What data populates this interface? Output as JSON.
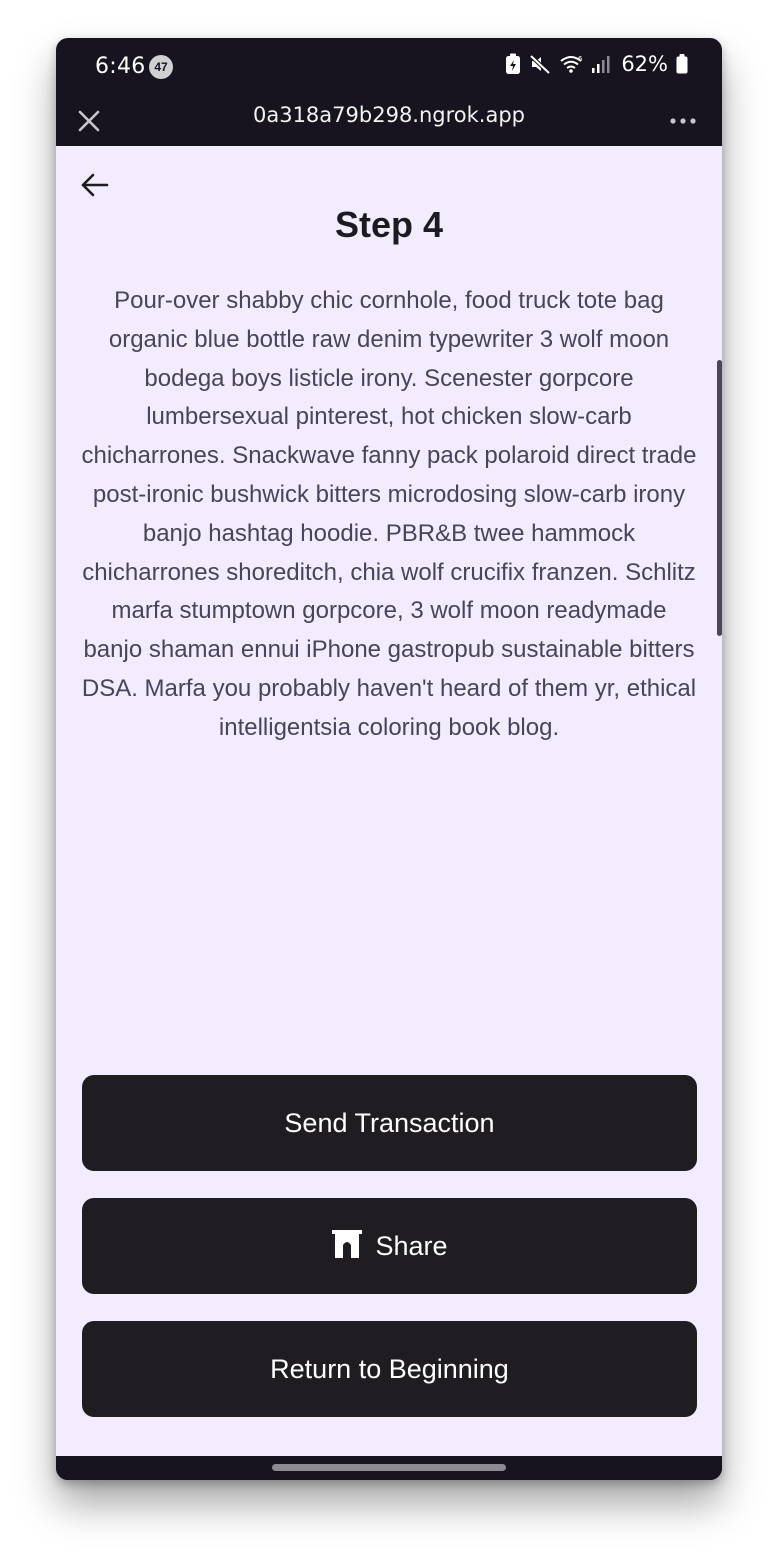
{
  "status_bar": {
    "time": "6:46",
    "notification_count": "47",
    "battery_percent": "62%",
    "icons": [
      "battery-saver-icon",
      "mute-icon",
      "wifi-icon",
      "signal-icon",
      "battery-icon"
    ]
  },
  "browser": {
    "url": "0a318a79b298.ngrok.app",
    "close_icon": "close-icon",
    "menu_icon": "more-icon"
  },
  "page": {
    "back_icon": "arrow-left-icon",
    "title": "Step 4",
    "body": "Pour-over shabby chic cornhole, food truck tote bag organic blue bottle raw denim typewriter 3 wolf moon bodega boys listicle irony. Scenester gorpcore lumbersexual pinterest, hot chicken slow-carb chicharrones. Snackwave fanny pack polaroid direct trade post-ironic bushwick bitters microdosing slow-carb irony banjo hashtag hoodie. PBR&B twee hammock chicharrones shoreditch, chia wolf crucifix franzen. Schlitz marfa stumptown gorpcore, 3 wolf moon readymade banjo shaman ennui iPhone gastropub sustainable bitters DSA. Marfa you probably haven't heard of them yr, ethical intelligentsia coloring book blog."
  },
  "actions": {
    "send_label": "Send Transaction",
    "share_label": "Share",
    "share_icon": "arch-icon",
    "return_label": "Return to Beginning"
  },
  "colors": {
    "page_background": "#f3ecff",
    "button_background": "#1f1d21",
    "chrome_background": "#17141f",
    "body_text": "#4a4458"
  }
}
